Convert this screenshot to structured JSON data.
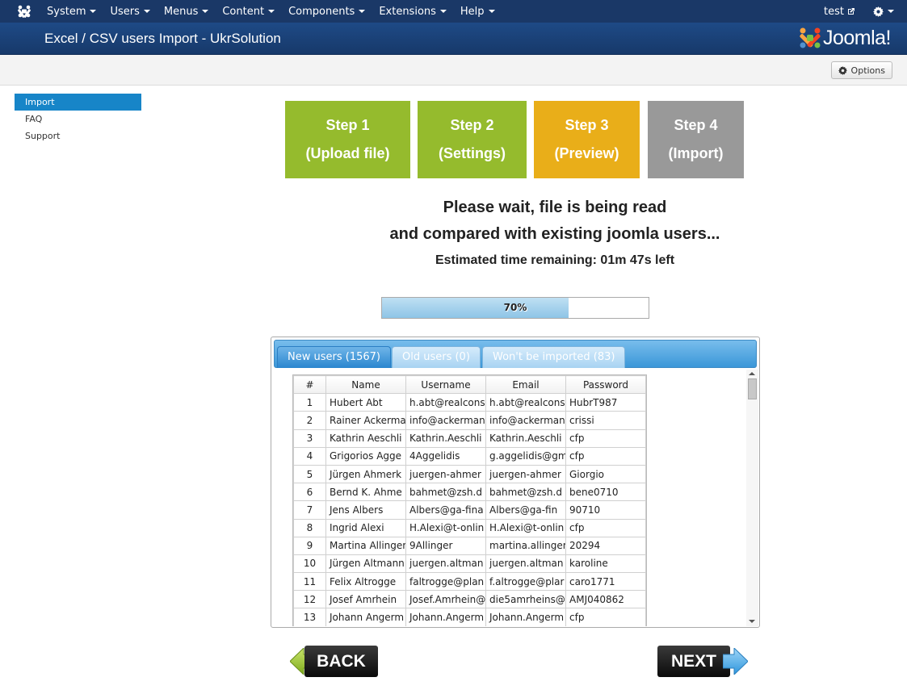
{
  "navbar": {
    "menu": [
      "System",
      "Users",
      "Menus",
      "Content",
      "Components",
      "Extensions",
      "Help"
    ],
    "user": "test"
  },
  "header": {
    "title": "Excel / CSV users Import - UkrSolution",
    "brand": "Joomla!"
  },
  "toolbar": {
    "options_label": "Options"
  },
  "sidebar": {
    "items": [
      "Import",
      "FAQ",
      "Support"
    ],
    "active": "Import"
  },
  "steps": [
    {
      "title": "Step 1",
      "subtitle": "(Upload file)",
      "color": "#95bb2d"
    },
    {
      "title": "Step 2",
      "subtitle": "(Settings)",
      "color": "#95bb2d"
    },
    {
      "title": "Step 3",
      "subtitle": "(Preview)",
      "color": "#e9ae19"
    },
    {
      "title": "Step 4",
      "subtitle": "(Import)",
      "color": "#999999"
    }
  ],
  "status": {
    "line1": "Please wait, file is being read",
    "line2": "and compared with existing joomla users...",
    "line3": "Estimated time remaining: 01m 47s left"
  },
  "progress": {
    "percent": 70,
    "label": "70%"
  },
  "tabs": [
    "New users (1567)",
    "Old users (0)",
    "Won't be imported (83)"
  ],
  "table": {
    "columns": [
      "#",
      "Name",
      "Username",
      "Email",
      "Password"
    ],
    "rows": [
      [
        "1",
        "Hubert Abt",
        "h.abt@realcons",
        "h.abt@realcons",
        "HubrT987"
      ],
      [
        "2",
        "Rainer Ackerma",
        "info@ackerman",
        "info@ackerman",
        "crissi"
      ],
      [
        "3",
        "Kathrin Aeschli",
        "Kathrin.Aeschli",
        "Kathrin.Aeschli",
        "cfp"
      ],
      [
        "4",
        "Grigorios Agge",
        "4Aggelidis",
        "g.aggelidis@gm",
        "cfp"
      ],
      [
        "5",
        "Jürgen Ahmerk",
        "juergen-ahmer",
        "juergen-ahmer",
        "Giorgio"
      ],
      [
        "6",
        "Bernd K. Ahme",
        "bahmet@zsh.d",
        "bahmet@zsh.d",
        "bene0710"
      ],
      [
        "7",
        "Jens Albers",
        "Albers@ga-fina",
        "Albers@ga-fin",
        "90710"
      ],
      [
        "8",
        "Ingrid Alexi",
        "H.Alexi@t-onlin",
        "H.Alexi@t-onlin",
        "cfp"
      ],
      [
        "9",
        "Martina Allinger",
        "9Allinger",
        "martina.allinger",
        "20294"
      ],
      [
        "10",
        "Jürgen Altmann",
        "juergen.altman",
        "juergen.altman",
        "karoline"
      ],
      [
        "11",
        "Felix Altrogge",
        "faltrogge@plan",
        "f.altrogge@plar",
        "caro1771"
      ],
      [
        "12",
        "Josef Amrhein",
        "Josef.Amrhein@",
        "die5amrheins@",
        "AMJ040862"
      ],
      [
        "13",
        "Johann Angerm",
        "Johann.Angerm",
        "Johann.Angerm",
        "cfp"
      ]
    ]
  },
  "buttons": {
    "back": "BACK",
    "next": "NEXT"
  }
}
